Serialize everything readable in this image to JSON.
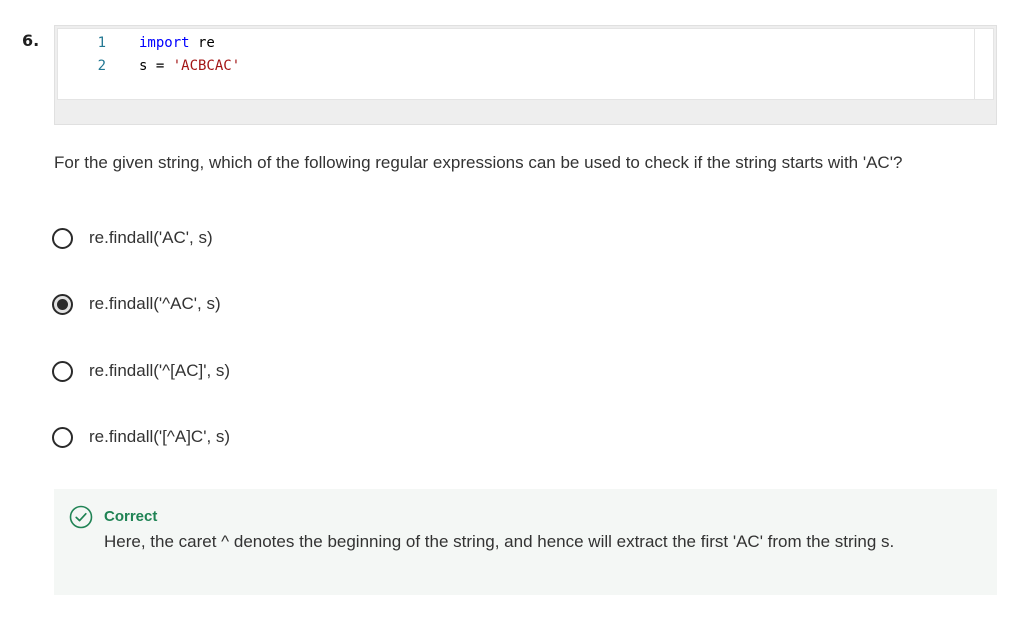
{
  "question": {
    "number": "6.",
    "text": "For the given string, which of the following regular expressions can be used to check if the string starts with 'AC'?"
  },
  "code": {
    "lines": [
      {
        "no": "1",
        "keyword": "import",
        "rest": " re"
      },
      {
        "no": "2",
        "lhs": "s = ",
        "string": "'ACBCAC'"
      }
    ]
  },
  "options": [
    {
      "label": "re.findall('AC', s)",
      "selected": false
    },
    {
      "label": "re.findall('^AC', s)",
      "selected": true
    },
    {
      "label": "re.findall('^[AC]', s)",
      "selected": false
    },
    {
      "label": "re.findall('[^A]C', s)",
      "selected": false
    }
  ],
  "feedback": {
    "status": "Correct",
    "explanation": "Here, the caret ^ denotes the beginning of the string, and hence will extract the first 'AC' from the string s.",
    "icon": "check-circle-icon",
    "color": "#1f8354"
  }
}
